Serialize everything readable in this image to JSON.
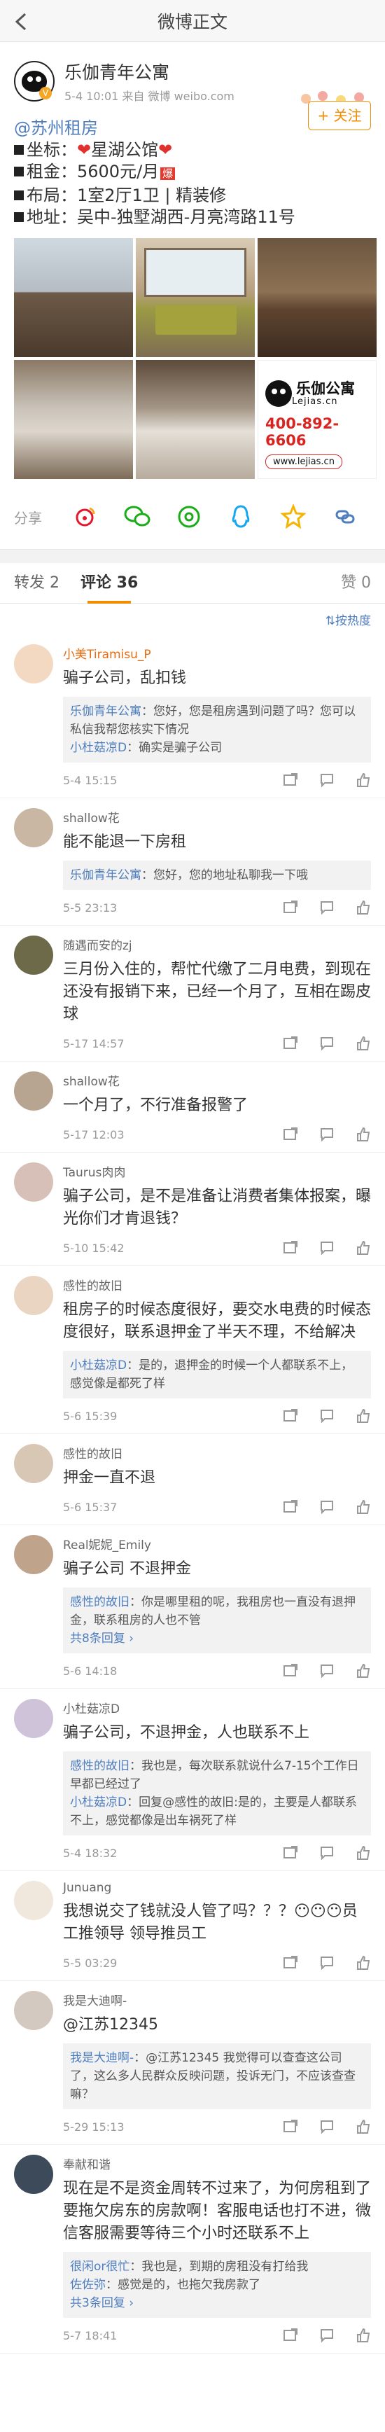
{
  "header": {
    "title": "微博正文"
  },
  "post": {
    "author": "乐伽青年公寓",
    "meta": "5-4 10:01  来自 微博 weibo.com",
    "follow_label": "+ 关注",
    "location": "@苏州租房",
    "lines": {
      "coord_label": "坐标：",
      "coord_value": "星湖公馆",
      "rent_label": "租金：",
      "rent_value": "5600元/月",
      "rent_badge": "爆",
      "layout_label": "布局：",
      "layout_value": "1室2厅1卫 | 精装修",
      "address_label": "地址：",
      "address_value": "吴中-独墅湖西-月亮湾路11号"
    },
    "ad": {
      "brand_cn": "乐伽公寓",
      "brand_en": "Lejias.cn",
      "phone": "400-892-6606",
      "web": "www.lejias.cn"
    },
    "share_label": "分享"
  },
  "tabs": {
    "reposts": "转发 2",
    "comments": "评论 36",
    "likes": "赞 0"
  },
  "sort_label": "⇅按热度",
  "comments": [
    {
      "name": "小美Tiramisu_P",
      "text": "骗子公司，乱扣钱",
      "time": "5-4 15:15",
      "replies": [
        {
          "name": "乐伽青年公寓",
          "text": "您好，您是租房遇到问题了吗？您可以私信我帮您核实下情况"
        },
        {
          "name": "小杜菇凉D",
          "text": "确实是骗子公司"
        }
      ],
      "more": ""
    },
    {
      "name": "shallow花",
      "text": "能不能退一下房租",
      "time": "5-5 23:13",
      "replies": [
        {
          "name": "乐伽青年公寓",
          "text": "您好，您的地址私聊我一下哦"
        }
      ],
      "more": ""
    },
    {
      "name": "随遇而安的zj",
      "text": "三月份入住的，帮忙代缴了二月电费，到现在还没有报销下来，已经一个月了，互相在踢皮球",
      "time": "5-17 14:57",
      "replies": [],
      "more": ""
    },
    {
      "name": "shallow花",
      "text": "一个月了，不行准备报警了",
      "time": "5-17 12:03",
      "replies": [],
      "more": ""
    },
    {
      "name": "Taurus肉肉",
      "text": "骗子公司，是不是准备让消费者集体报案，曝光你们才肯退钱？",
      "time": "5-10 15:42",
      "replies": [],
      "more": ""
    },
    {
      "name": "感性的故旧",
      "text": "租房子的时候态度很好，要交水电费的时候态度很好，联系退押金了半天不理，不给解决",
      "time": "5-6 15:39",
      "replies": [
        {
          "name": "小杜菇凉D",
          "text": "是的，退押金的时候一个人都联系不上，感觉像是都死了样"
        }
      ],
      "more": ""
    },
    {
      "name": "感性的故旧",
      "text": "押金一直不退",
      "time": "5-6 15:37",
      "replies": [],
      "more": ""
    },
    {
      "name": "Real妮妮_Emily",
      "text": "骗子公司 不退押金",
      "time": "5-6 14:18",
      "replies": [
        {
          "name": "感性的故旧",
          "text": "你是哪里租的呢，我租房也一直没有退押金，联系租房的人也不管"
        }
      ],
      "more": "共8条回复 ›"
    },
    {
      "name": "小杜菇凉D",
      "text": "骗子公司，不退押金，人也联系不上",
      "time": "5-4 18:32",
      "replies": [
        {
          "name": "感性的故旧",
          "text": "我也是，每次联系就说什么7-15个工作日 早都已经过了"
        },
        {
          "name": "小杜菇凉D",
          "text": "回复@感性的故旧:是的，主要是人都联系不上，感觉都像是出车祸死了样"
        }
      ],
      "more": ""
    },
    {
      "name": "Junuang",
      "text": "我想说交了钱就没人管了吗？？？😶😶😶员工推领导 领导推员工",
      "time": "5-5 03:29",
      "replies": [],
      "more": ""
    },
    {
      "name": "我是大迪啊-",
      "text": "@江苏12345",
      "time": "5-29 15:13",
      "replies": [
        {
          "name": "我是大迪啊-",
          "text": "@江苏12345 我觉得可以查查这公司了，这么多人民群众反映问题，投诉无门，不应该查查嘛？"
        }
      ],
      "more": ""
    },
    {
      "name": "奉献和谐",
      "text": "现在是不是资金周转不过来了，为何房租到了要拖欠房东的房款啊！客服电话也打不进，微信客服需要等待三个小时还联系不上",
      "time": "5-7 18:41",
      "replies": [
        {
          "name": "很闲or很忙",
          "text": "我也是，到期的房租没有打给我"
        },
        {
          "name": "佐佐弥",
          "text": "感觉是的，也拖欠我房款了"
        }
      ],
      "more": "共3条回复 ›"
    }
  ],
  "colors": {
    "accent": "#f18c00",
    "link": "#4f7ebf",
    "brand_red": "#d92420"
  }
}
